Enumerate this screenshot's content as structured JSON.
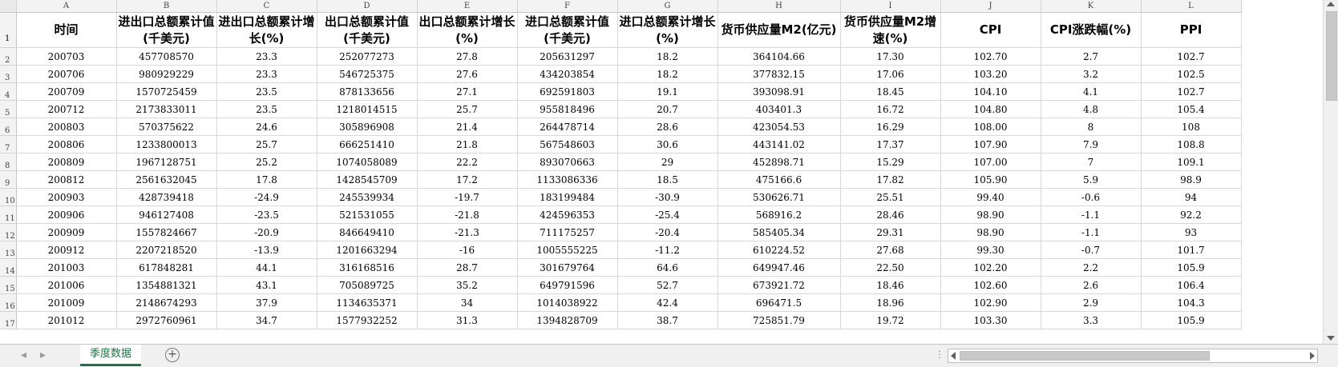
{
  "columns": [
    "A",
    "B",
    "C",
    "D",
    "E",
    "F",
    "G",
    "H",
    "I",
    "J",
    "K",
    "L"
  ],
  "headers": [
    "时间",
    "进出口总额累计值(千美元)",
    "进出口总额累计增长(%)",
    "出口总额累计值(千美元)",
    "出口总额累计增长(%)",
    "进口总额累计值(千美元)",
    "进口总额累计增长(%)",
    "货币供应量M2(亿元)",
    "货币供应量M2增速(%)",
    "CPI",
    "CPI涨跌幅(%)",
    "PPI"
  ],
  "rows": [
    [
      "200703",
      "457708570",
      "23.3",
      "252077273",
      "27.8",
      "205631297",
      "18.2",
      "364104.66",
      "17.30",
      "102.70",
      "2.7",
      "102.7"
    ],
    [
      "200706",
      "980929229",
      "23.3",
      "546725375",
      "27.6",
      "434203854",
      "18.2",
      "377832.15",
      "17.06",
      "103.20",
      "3.2",
      "102.5"
    ],
    [
      "200709",
      "1570725459",
      "23.5",
      "878133656",
      "27.1",
      "692591803",
      "19.1",
      "393098.91",
      "18.45",
      "104.10",
      "4.1",
      "102.7"
    ],
    [
      "200712",
      "2173833011",
      "23.5",
      "1218014515",
      "25.7",
      "955818496",
      "20.7",
      "403401.3",
      "16.72",
      "104.80",
      "4.8",
      "105.4"
    ],
    [
      "200803",
      "570375622",
      "24.6",
      "305896908",
      "21.4",
      "264478714",
      "28.6",
      "423054.53",
      "16.29",
      "108.00",
      "8",
      "108"
    ],
    [
      "200806",
      "1233800013",
      "25.7",
      "666251410",
      "21.8",
      "567548603",
      "30.6",
      "443141.02",
      "17.37",
      "107.90",
      "7.9",
      "108.8"
    ],
    [
      "200809",
      "1967128751",
      "25.2",
      "1074058089",
      "22.2",
      "893070663",
      "29",
      "452898.71",
      "15.29",
      "107.00",
      "7",
      "109.1"
    ],
    [
      "200812",
      "2561632045",
      "17.8",
      "1428545709",
      "17.2",
      "1133086336",
      "18.5",
      "475166.6",
      "17.82",
      "105.90",
      "5.9",
      "98.9"
    ],
    [
      "200903",
      "428739418",
      "-24.9",
      "245539934",
      "-19.7",
      "183199484",
      "-30.9",
      "530626.71",
      "25.51",
      "99.40",
      "-0.6",
      "94"
    ],
    [
      "200906",
      "946127408",
      "-23.5",
      "521531055",
      "-21.8",
      "424596353",
      "-25.4",
      "568916.2",
      "28.46",
      "98.90",
      "-1.1",
      "92.2"
    ],
    [
      "200909",
      "1557824667",
      "-20.9",
      "846649410",
      "-21.3",
      "711175257",
      "-20.4",
      "585405.34",
      "29.31",
      "98.90",
      "-1.1",
      "93"
    ],
    [
      "200912",
      "2207218520",
      "-13.9",
      "1201663294",
      "-16",
      "1005555225",
      "-11.2",
      "610224.52",
      "27.68",
      "99.30",
      "-0.7",
      "101.7"
    ],
    [
      "201003",
      "617848281",
      "44.1",
      "316168516",
      "28.7",
      "301679764",
      "64.6",
      "649947.46",
      "22.50",
      "102.20",
      "2.2",
      "105.9"
    ],
    [
      "201006",
      "1354881321",
      "43.1",
      "705089725",
      "35.2",
      "649791596",
      "52.7",
      "673921.72",
      "18.46",
      "102.60",
      "2.6",
      "106.4"
    ],
    [
      "201009",
      "2148674293",
      "37.9",
      "1134635371",
      "34",
      "1014038922",
      "42.4",
      "696471.5",
      "18.96",
      "102.90",
      "2.9",
      "104.3"
    ],
    [
      "201012",
      "2972760961",
      "34.7",
      "1577932252",
      "31.3",
      "1394828709",
      "38.7",
      "725851.79",
      "19.72",
      "103.30",
      "3.3",
      "105.9"
    ]
  ],
  "sheet_tab": "季度数据",
  "colors": {
    "accent": "#217346",
    "header_bg": "#f3f3f3",
    "grid": "#d8d8d8"
  }
}
